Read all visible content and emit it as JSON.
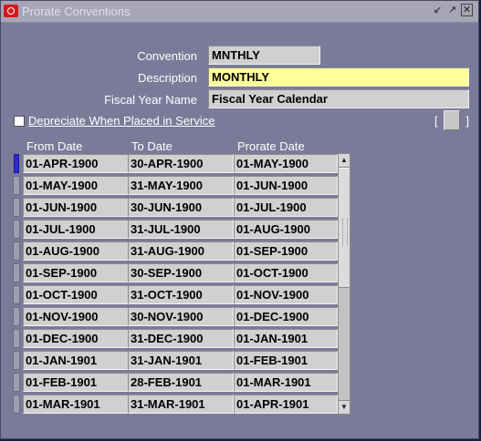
{
  "window": {
    "title": "Prorate Conventions"
  },
  "form": {
    "convention_label": "Convention",
    "convention_value": "MNTHLY",
    "description_label": "Description",
    "description_value": "MONTHLY",
    "fiscal_year_label": "Fiscal Year Name",
    "fiscal_year_value": "Fiscal Year Calendar",
    "depreciate_label": "Depreciate When Placed in Service",
    "depreciate_checked": false,
    "dff_left": "[",
    "dff_right": "]"
  },
  "table": {
    "headers": {
      "from": "From Date",
      "to": "To Date",
      "prorate": "Prorate Date"
    },
    "rows": [
      {
        "from": "01-APR-1900",
        "to": "30-APR-1900",
        "prorate": "01-MAY-1900"
      },
      {
        "from": "01-MAY-1900",
        "to": "31-MAY-1900",
        "prorate": "01-JUN-1900"
      },
      {
        "from": "01-JUN-1900",
        "to": "30-JUN-1900",
        "prorate": "01-JUL-1900"
      },
      {
        "from": "01-JUL-1900",
        "to": "31-JUL-1900",
        "prorate": "01-AUG-1900"
      },
      {
        "from": "01-AUG-1900",
        "to": "31-AUG-1900",
        "prorate": "01-SEP-1900"
      },
      {
        "from": "01-SEP-1900",
        "to": "30-SEP-1900",
        "prorate": "01-OCT-1900"
      },
      {
        "from": "01-OCT-1900",
        "to": "31-OCT-1900",
        "prorate": "01-NOV-1900"
      },
      {
        "from": "01-NOV-1900",
        "to": "30-NOV-1900",
        "prorate": "01-DEC-1900"
      },
      {
        "from": "01-DEC-1900",
        "to": "31-DEC-1900",
        "prorate": "01-JAN-1901"
      },
      {
        "from": "01-JAN-1901",
        "to": "31-JAN-1901",
        "prorate": "01-FEB-1901"
      },
      {
        "from": "01-FEB-1901",
        "to": "28-FEB-1901",
        "prorate": "01-MAR-1901"
      },
      {
        "from": "01-MAR-1901",
        "to": "31-MAR-1901",
        "prorate": "01-APR-1901"
      }
    ]
  },
  "icons": {
    "app": "oracle-logo-icon",
    "minimize": "minimize-icon",
    "maximize": "maximize-icon",
    "close": "close-icon"
  },
  "colors": {
    "window_bg": "#7b7b99",
    "titlebar_bg": "#a6a6b6",
    "field_bg": "#d0d0d0",
    "active_field_bg": "#ffff99",
    "current_record_indicator": "#2a2ad8"
  }
}
